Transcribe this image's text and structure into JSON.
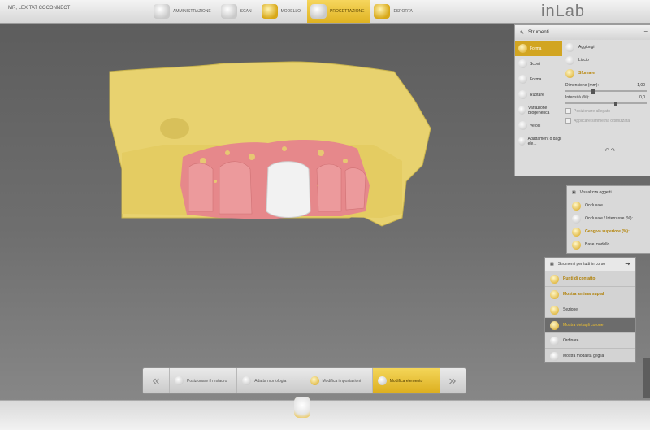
{
  "app": {
    "case_label": "MR, LEX TAT COCONNECT",
    "logo": "inLab"
  },
  "steps": [
    {
      "label": "AMMINISTRAZIONE"
    },
    {
      "label": "SCAN"
    },
    {
      "label": "MODELLO"
    },
    {
      "label": "PROGETTAZIONE"
    },
    {
      "label": "ESPORTA"
    }
  ],
  "tools_panel": {
    "title": "Strumenti",
    "left_items": [
      "Forma",
      "Scorri",
      "Forma",
      "Ruotare",
      "Variazione Biogenerica",
      "Veloci",
      "Adattament o dagli ele..."
    ],
    "right_items": [
      "Aggiungi",
      "Liscio",
      "Sfumare"
    ],
    "size_label": "Dimensione (mm):",
    "size_value": "1,00",
    "intensity_label": "Intensità (%):",
    "intensity_value": "0,0",
    "opt1": "Posizionare allegato",
    "opt2": "Applicare simmetria ottimizzata"
  },
  "visualization": {
    "title": "Visualizza oggetti",
    "row1": "Occlusale",
    "row2": "Occlusale / Interrasse (%):",
    "row3": "Gengiva superiore (%):",
    "row4": "Base modello"
  },
  "design_tools": {
    "title": "Strumenti per tutti in corso",
    "items": [
      "Punti di contatto",
      "Mostra antimarsupial",
      "Sezione",
      "Mostra dettagli corone",
      "Ordinare",
      "Mostra modalità griglia"
    ]
  },
  "bottom_nav": {
    "prev": "«",
    "next": "»",
    "items": [
      "Posizionare il restauro",
      "Adatta morfologia",
      "Modifica impostazioni",
      "Modifica elemento"
    ]
  },
  "colors": {
    "accent": "#e0b322",
    "gingiva": "#e6888b",
    "model": "#e8d26f"
  }
}
